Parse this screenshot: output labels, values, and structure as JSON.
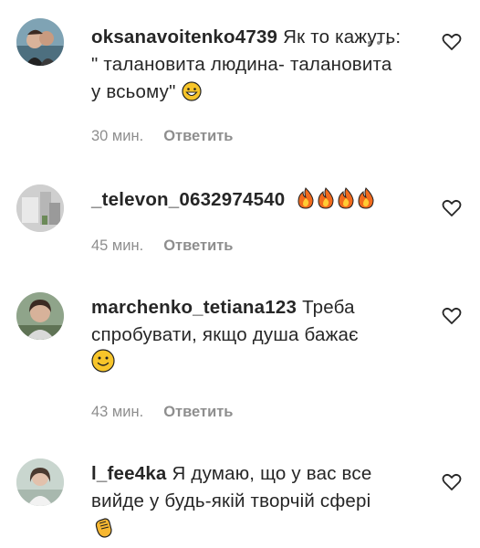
{
  "comments": [
    {
      "username": "oksanavoitenko4739",
      "text": "Як то кажуть: \" талановита людина- талановита у всьому\"",
      "time": "30 мин.",
      "reply_label": "Ответить",
      "emoji": "grinning-face-icon"
    },
    {
      "username": "_televon_0632974540",
      "text": "",
      "time": "45 мин.",
      "reply_label": "Ответить",
      "emoji": "fire-icon x4"
    },
    {
      "username": "marchenko_tetiana123",
      "text": "Треба спробувати, якщо душа бажає",
      "time": "43 мин.",
      "reply_label": "Ответить",
      "emoji": "slightly-smiling-face-icon"
    },
    {
      "username": "l_fee4ka",
      "text": "Я думаю, що у вас все вийде у будь-якій творчій сфері",
      "time": "",
      "reply_label": "",
      "emoji": "clapping-hands-icon"
    }
  ],
  "colors": {
    "text": "#262626",
    "muted": "#8e8e8e",
    "background": "#ffffff"
  }
}
